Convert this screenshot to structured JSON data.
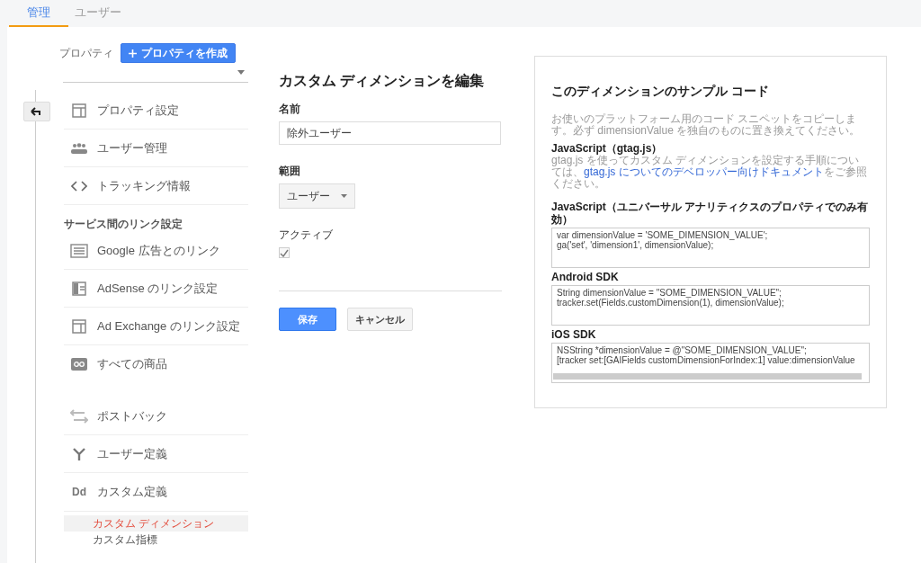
{
  "tabs": [
    {
      "label": "管理",
      "selected": true
    },
    {
      "label": "ユーザー",
      "selected": false
    }
  ],
  "property": {
    "label": "プロパティ",
    "create_button": "プロパティを作成"
  },
  "nav_sections": [
    {
      "items": [
        {
          "label": "プロパティ設定"
        },
        {
          "label": "ユーザー管理"
        },
        {
          "label": "トラッキング情報"
        }
      ]
    },
    {
      "header": "サービス間のリンク設定",
      "items": [
        {
          "label": "Google 広告とのリンク"
        },
        {
          "label": "AdSense のリンク設定"
        },
        {
          "label": "Ad Exchange のリンク設定"
        },
        {
          "label": "すべての商品"
        }
      ]
    },
    {
      "items": [
        {
          "label": "ポストバック"
        },
        {
          "label": "ユーザー定義"
        },
        {
          "label": "カスタム定義",
          "icon_text": "Dd",
          "children": [
            {
              "label": "カスタム ディメンション",
              "selected": true
            },
            {
              "label": "カスタム指標",
              "selected": false
            }
          ]
        }
      ]
    }
  ],
  "form": {
    "title": "カスタム ディメンションを編集",
    "name_label": "名前",
    "name_value": "除外ユーザー",
    "scope_label": "範囲",
    "scope_value": "ユーザー",
    "active_label": "アクティブ",
    "active_checked": true,
    "save_button": "保存",
    "cancel_button": "キャンセル"
  },
  "sample_code": {
    "title": "このディメンションのサンプル コード",
    "intro": "お使いのプラットフォーム用のコード スニペットをコピーします。必ず dimensionValue を独自のものに置き換えてください。",
    "gtag_heading": "JavaScript（gtag.js）",
    "gtag_text_before": "gtag.js を使ってカスタム ディメンションを設定する手順については、",
    "gtag_link": "gtag.js についてのデベロッパー向けドキュメント",
    "gtag_text_after": "をご参照ください。",
    "snippets": [
      {
        "heading": "JavaScript（ユニバーサル アナリティクスのプロパティでのみ有効）",
        "lines": [
          "var dimensionValue = 'SOME_DIMENSION_VALUE';",
          "ga('set', 'dimension1', dimensionValue);"
        ]
      },
      {
        "heading": "Android SDK",
        "lines": [
          "String dimensionValue = \"SOME_DIMENSION_VALUE\";",
          "tracker.set(Fields.customDimension(1), dimensionValue);"
        ]
      },
      {
        "heading": "iOS SDK",
        "lines": [
          "NSString *dimensionValue = @\"SOME_DIMENSION_VALUE\";",
          "[tracker set:[GAIFields customDimensionForIndex:1] value:dimensionValue"
        ]
      }
    ]
  }
}
